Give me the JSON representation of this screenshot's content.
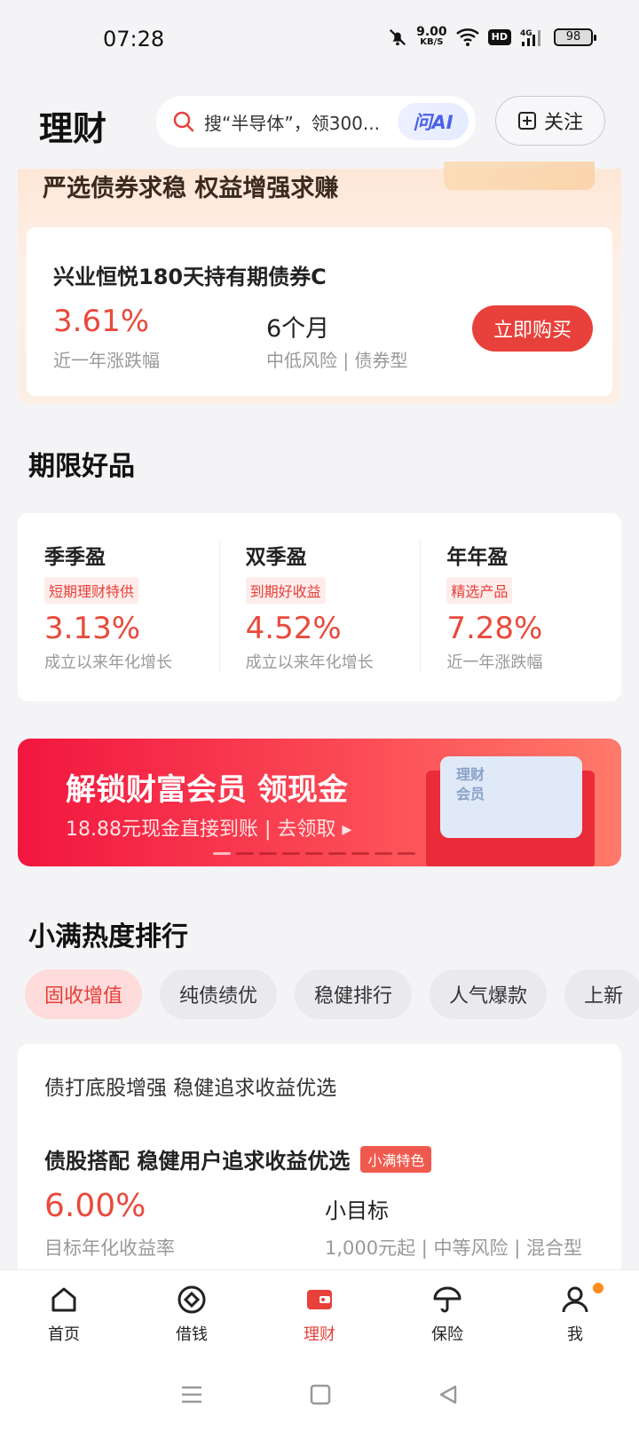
{
  "status": {
    "time": "07:28",
    "net_speed_value": "9.00",
    "net_speed_unit": "KB/S",
    "hd": "HD",
    "battery": "98"
  },
  "header": {
    "title": "理财",
    "search_placeholder": "搜“半导体”，领300...",
    "ai_label": "问AI",
    "follow_label": "关注"
  },
  "promo": {
    "headline": "严选债券求稳 权益增强求赚",
    "fund_name": "兴业恒悦180天持有期债券C",
    "rate": "3.61%",
    "rate_label": "近一年涨跌幅",
    "term": "6个月",
    "term_label": "中低风险 | 债券型",
    "buy_label": "立即购买"
  },
  "period": {
    "title": "期限好品",
    "items": [
      {
        "name": "季季盈",
        "tag": "短期理财特供",
        "rate": "3.13%",
        "label": "成立以来年化增长"
      },
      {
        "name": "双季盈",
        "tag": "到期好收益",
        "rate": "4.52%",
        "label": "成立以来年化增长"
      },
      {
        "name": "年年盈",
        "tag": "精选产品",
        "rate": "7.28%",
        "label": "近一年涨跌幅"
      }
    ]
  },
  "banner": {
    "title": "解锁财富会员 领现金",
    "subtitle": "18.88元现金直接到账 |  去领取 ▸",
    "card_text_line1": "理财",
    "card_text_line2": "会员"
  },
  "ranking": {
    "title": "小满热度排行",
    "chips": [
      "固收增值",
      "纯债绩优",
      "稳健排行",
      "人气爆款",
      "上新"
    ],
    "subtitle": "债打底股增强 稳健追求收益优选",
    "product_title": "债股搭配 稳健用户追求收益优选",
    "badge": "小满特色",
    "rate": "6.00%",
    "rate_label": "目标年化收益率",
    "goal": "小目标",
    "goal_meta": "1,000元起 | 中等风险 | 混合型"
  },
  "tabs": [
    {
      "label": "首页",
      "icon": "home-icon"
    },
    {
      "label": "借钱",
      "icon": "loan-icon"
    },
    {
      "label": "理财",
      "icon": "wallet-icon"
    },
    {
      "label": "保险",
      "icon": "umbrella-icon"
    },
    {
      "label": "我",
      "icon": "person-icon"
    }
  ],
  "colors": {
    "accent": "#e8403a",
    "rate_red": "#e84a3c",
    "background": "#f4f4f6"
  }
}
